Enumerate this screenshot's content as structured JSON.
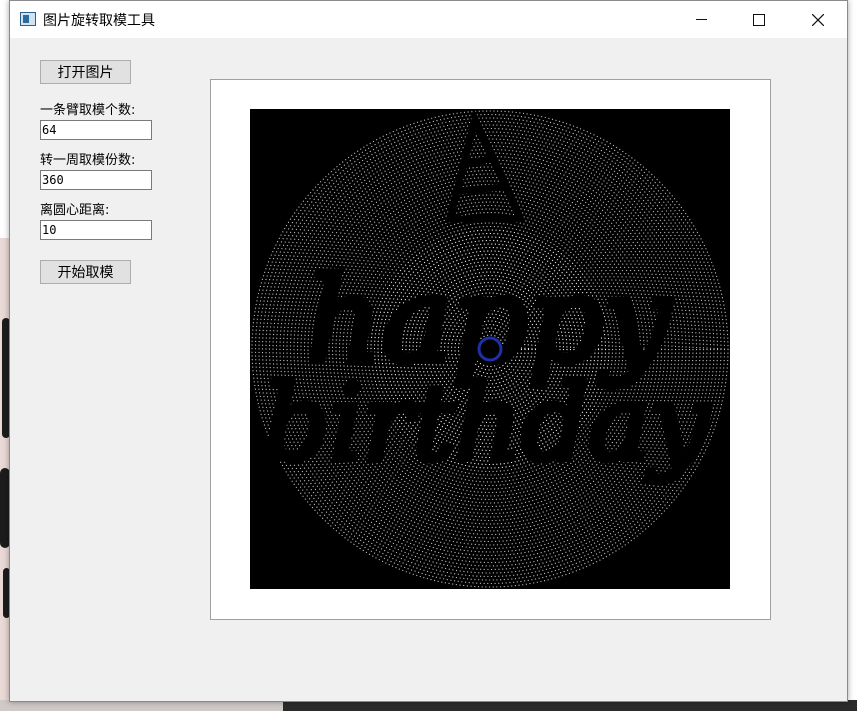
{
  "window": {
    "title": "图片旋转取模工具",
    "icons": {
      "app": "app-window-icon",
      "minimize": "minimize-icon",
      "maximize": "maximize-icon",
      "close": "close-icon"
    }
  },
  "controls": {
    "open_button": "打开图片",
    "arm_count_label": "一条臂取模个数:",
    "arm_count_value": "64",
    "per_rotation_label": "转一周取模份数:",
    "per_rotation_value": "360",
    "center_distance_label": "离圆心距离:",
    "center_distance_value": "10",
    "start_button": "开始取模"
  },
  "preview": {
    "text_lines": [
      "happy",
      "birthday"
    ],
    "background_color": "#000000",
    "dot_color": "#ffffff",
    "center_marker_color": "#1f2fa8"
  }
}
